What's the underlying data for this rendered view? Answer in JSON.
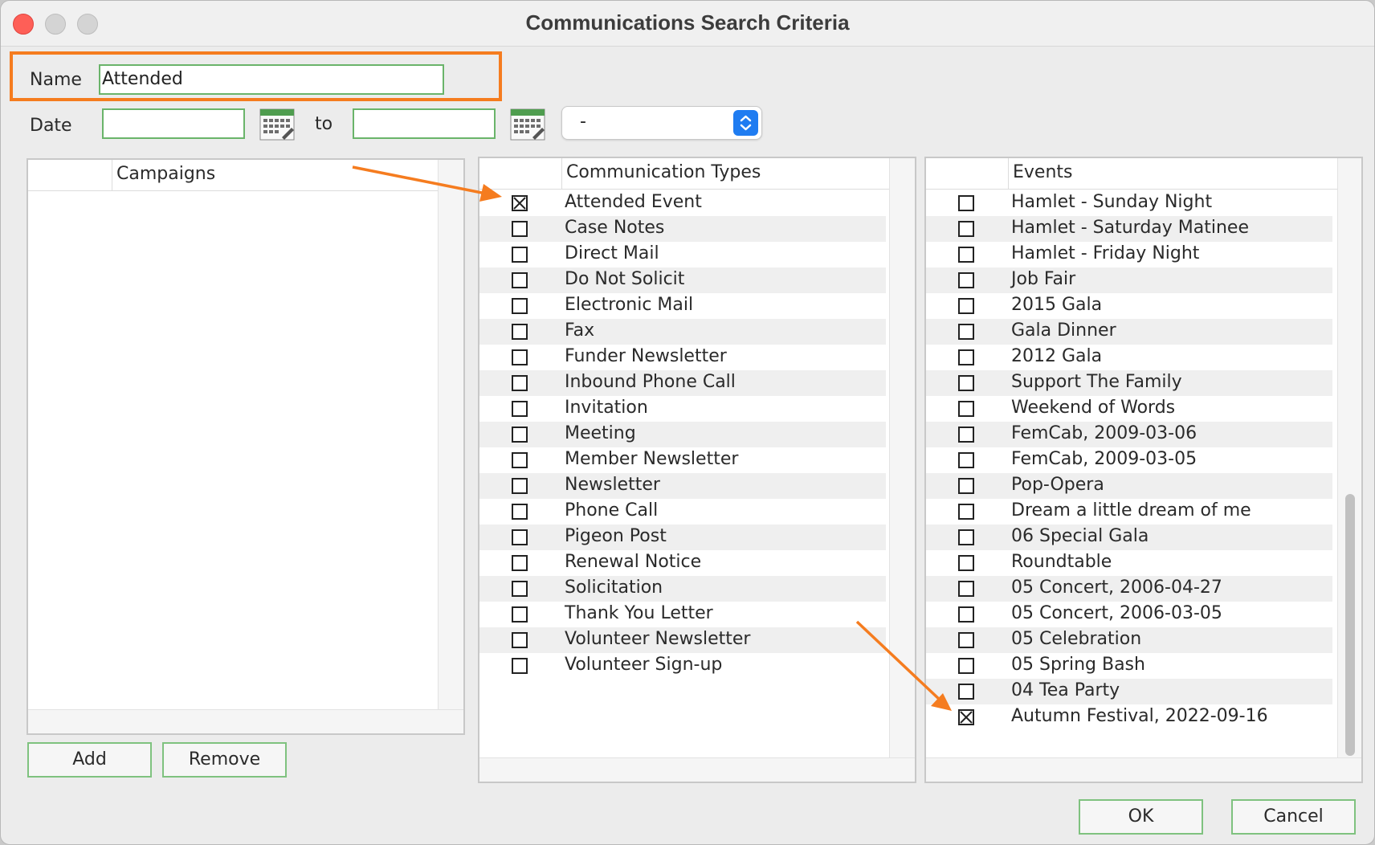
{
  "window": {
    "title": "Communications Search Criteria"
  },
  "form": {
    "name_label": "Name",
    "name_value": "Attended",
    "date_label": "Date",
    "date_from": "",
    "date_to": "",
    "to_label": "to",
    "range_select_value": "-"
  },
  "campaigns": {
    "header": "Campaigns",
    "add_label": "Add",
    "remove_label": "Remove"
  },
  "communication_types": {
    "header": "Communication Types",
    "items": [
      {
        "label": "Attended Event",
        "checked": true
      },
      {
        "label": "Case Notes",
        "checked": false
      },
      {
        "label": "Direct Mail",
        "checked": false
      },
      {
        "label": "Do Not Solicit",
        "checked": false
      },
      {
        "label": "Electronic Mail",
        "checked": false
      },
      {
        "label": "Fax",
        "checked": false
      },
      {
        "label": "Funder Newsletter",
        "checked": false
      },
      {
        "label": "Inbound Phone Call",
        "checked": false
      },
      {
        "label": "Invitation",
        "checked": false
      },
      {
        "label": "Meeting",
        "checked": false
      },
      {
        "label": "Member Newsletter",
        "checked": false
      },
      {
        "label": "Newsletter",
        "checked": false
      },
      {
        "label": "Phone Call",
        "checked": false
      },
      {
        "label": "Pigeon Post",
        "checked": false
      },
      {
        "label": "Renewal Notice",
        "checked": false
      },
      {
        "label": "Solicitation",
        "checked": false
      },
      {
        "label": "Thank You Letter",
        "checked": false
      },
      {
        "label": "Volunteer Newsletter",
        "checked": false
      },
      {
        "label": "Volunteer Sign-up",
        "checked": false
      }
    ]
  },
  "events": {
    "header": "Events",
    "items": [
      {
        "label": "Hamlet - Sunday Night",
        "checked": false
      },
      {
        "label": "Hamlet - Saturday Matinee",
        "checked": false
      },
      {
        "label": "Hamlet - Friday Night",
        "checked": false
      },
      {
        "label": "Job Fair",
        "checked": false
      },
      {
        "label": "2015 Gala",
        "checked": false
      },
      {
        "label": "Gala Dinner",
        "checked": false
      },
      {
        "label": "2012 Gala",
        "checked": false
      },
      {
        "label": "Support The Family",
        "checked": false
      },
      {
        "label": "Weekend of Words",
        "checked": false
      },
      {
        "label": "FemCab, 2009-03-06",
        "checked": false
      },
      {
        "label": "FemCab, 2009-03-05",
        "checked": false
      },
      {
        "label": "Pop-Opera",
        "checked": false
      },
      {
        "label": "Dream a little dream of me",
        "checked": false
      },
      {
        "label": "06 Special Gala",
        "checked": false
      },
      {
        "label": "Roundtable",
        "checked": false
      },
      {
        "label": "05 Concert, 2006-04-27",
        "checked": false
      },
      {
        "label": "05 Concert, 2006-03-05",
        "checked": false
      },
      {
        "label": "05 Celebration",
        "checked": false
      },
      {
        "label": "05 Spring Bash",
        "checked": false
      },
      {
        "label": "04 Tea Party",
        "checked": false
      },
      {
        "label": "Autumn Festival, 2022-09-16",
        "checked": true
      }
    ]
  },
  "footer": {
    "ok_label": "OK",
    "cancel_label": "Cancel"
  },
  "colors": {
    "accent": "#f57c1f",
    "field_border": "#6ab46a",
    "select_stepper": "#1f7cf1"
  }
}
